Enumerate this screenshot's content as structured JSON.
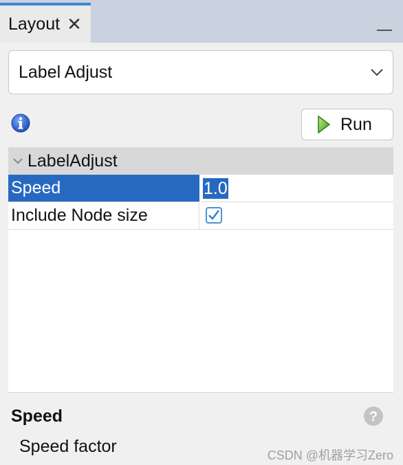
{
  "tab": {
    "label": "Layout",
    "close_glyph": "✕"
  },
  "layout_select": {
    "value": "Label Adjust"
  },
  "toolbar": {
    "run_label": "Run",
    "info_icon": "info-icon"
  },
  "properties": {
    "category": "LabelAdjust",
    "rows": [
      {
        "name": "Speed",
        "value": "1.0",
        "selected": true
      },
      {
        "name": "Include Node size",
        "value": true
      }
    ]
  },
  "description": {
    "title": "Speed",
    "text": "Speed factor"
  },
  "watermark": "CSDN @机器学习Zero",
  "colors": {
    "accent": "#3d86d6",
    "selection": "#2769c0",
    "category_bg": "#d8d8d8",
    "tabbar": "#c9d2de"
  }
}
